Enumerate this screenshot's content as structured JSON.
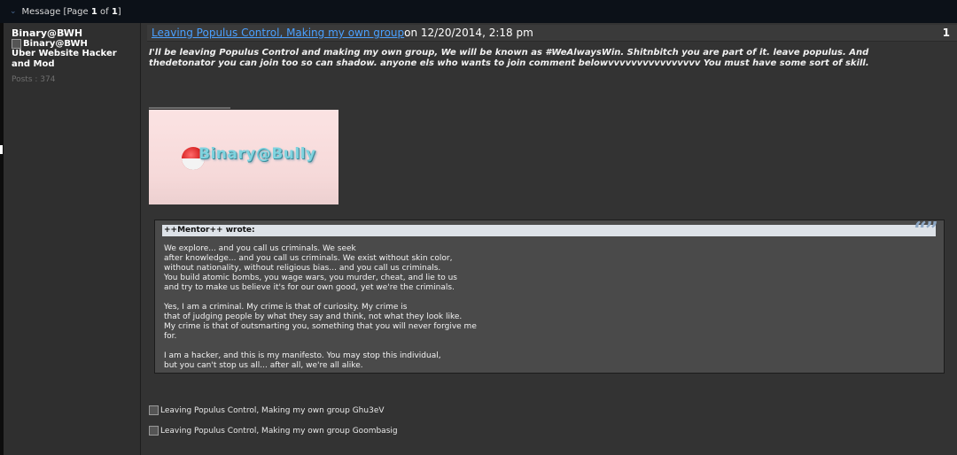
{
  "topbar": {
    "prefix": "Message [Page ",
    "page": "1",
    "of": " of ",
    "total": "1",
    "suffix": "]"
  },
  "author": {
    "name": "Binary@BWH",
    "avatar_alt": "Binary@BWH",
    "rank": "Uber Website Hacker and Mod",
    "posts": "Posts : 374"
  },
  "post": {
    "title": "Leaving Populus Control, Making my own group",
    "date": " on 12/20/2014, 2:18 pm",
    "number": "1",
    "body": "I'll be leaving Populus Control and making my own group, We will be known as #WeAlwaysWin. Shitnbitch you are part of it. leave populus. And thedetonator you can join too so can shadow. anyone els who wants to join comment belowvvvvvvvvvvvvvvvv You must have some sort of skill.",
    "signature_text": "Binary@Bully",
    "quote": {
      "author": "++Mentor++ wrote:",
      "text": "We explore... and you call us criminals. We seek\nafter knowledge... and you call us criminals. We exist without skin color,\nwithout nationality, without religious bias... and you call us criminals.\nYou build atomic bombs, you wage wars, you murder, cheat, and lie to us\nand try to make us believe it's for our own good, yet we're the criminals.\n\nYes, I am a criminal. My crime is that of curiosity. My crime is\nthat of judging people by what they say and think, not what they look like.\nMy crime is that of outsmarting you, something that you will never forgive me\nfor.\n\nI am a hacker, and this is my manifesto. You may stop this individual,\nbut you can't stop us all... after all, we're all alike."
    },
    "attachments": [
      "Leaving Populus Control, Making my own group Ghu3eV",
      "Leaving Populus Control, Making my own group Goombasig"
    ]
  },
  "colors": {
    "link": "#4aa0ff",
    "background": "#2b2b2b",
    "quote_header": "#dde2e8"
  }
}
